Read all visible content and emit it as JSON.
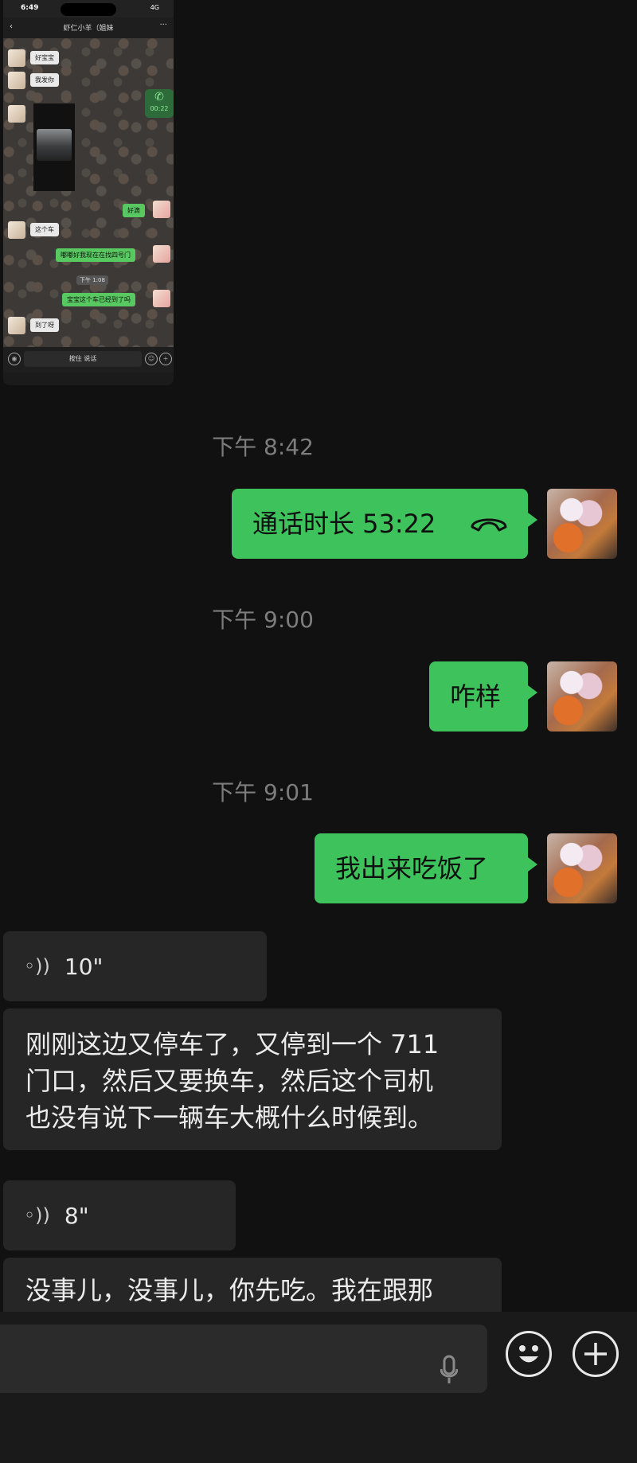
{
  "embedded_screenshot": {
    "status_time": "6:49",
    "status_signal": "4G",
    "contact_title": "虾仁小羊（姐妹",
    "call_duration": "00:22",
    "messages": [
      {
        "text": "好宝宝"
      },
      {
        "text": "我发你"
      },
      {
        "text": "好滴"
      },
      {
        "text": "这个车"
      },
      {
        "text": "嘟嘟好我现在在找四号门"
      },
      {
        "text": "宝宝这个车已经到了吗"
      },
      {
        "text": "到了呀"
      }
    ],
    "time_separator": "下午 1:08",
    "input_label": "按住 说话"
  },
  "conversation": {
    "timestamps": [
      "下午 8:42",
      "下午 9:00",
      "下午 9:01"
    ],
    "call_bubble": {
      "label": "通话时长 53:22"
    },
    "outgoing": [
      {
        "text": "咋样"
      },
      {
        "text": "我出来吃饭了"
      }
    ],
    "voice_messages": [
      {
        "duration": "10\"",
        "transcript": [
          "刚刚这边又停车了，又停到一个 711",
          "门口，然后又要换车，然后这个司机",
          "也没有说下一辆车大概什么时候到。"
        ]
      },
      {
        "duration": "8\"",
        "transcript": [
          "没事儿，没事儿，你先吃。我在跟那"
        ]
      }
    ]
  },
  "icons": {
    "call": "phone-hangup-icon",
    "voice": "voice-wave-icon",
    "mic": "microphone-icon",
    "emoji": "emoji-icon",
    "plus": "plus-icon"
  },
  "colors": {
    "background": "#111111",
    "outgoing_bubble": "#3ec35c",
    "incoming_bubble": "#262626",
    "timestamp": "#7d7d7d"
  }
}
